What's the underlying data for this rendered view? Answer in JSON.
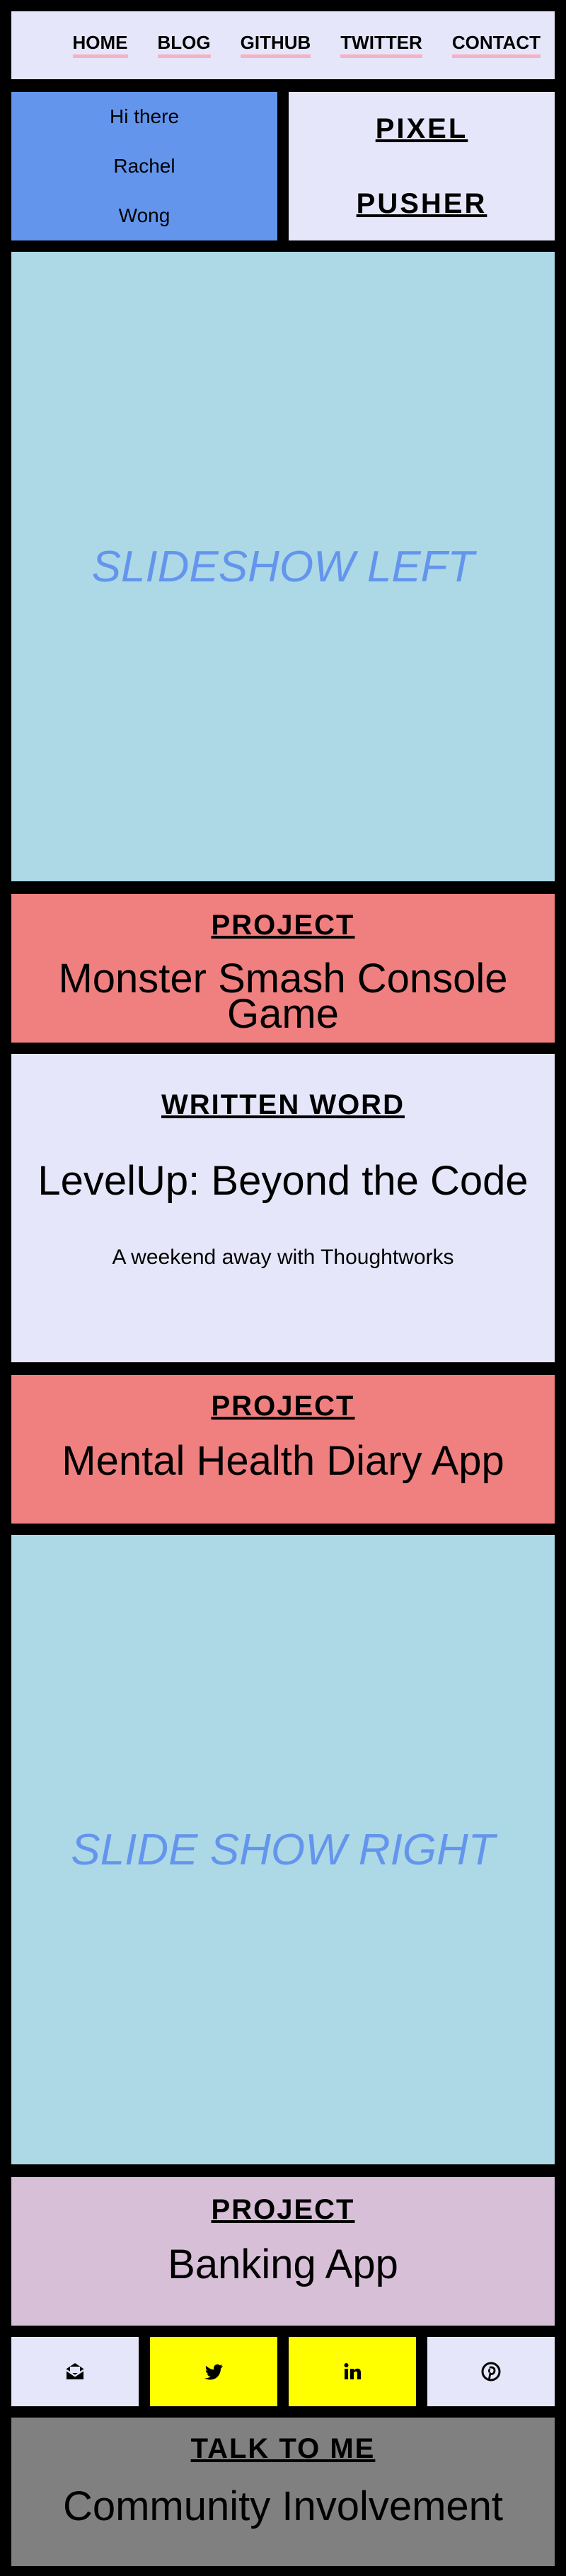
{
  "nav": {
    "items": [
      "HOME",
      "BLOG",
      "GITHUB",
      "TWITTER",
      "CONTACT"
    ]
  },
  "hero": {
    "greeting": [
      "Hi there",
      "Rachel",
      "Wong"
    ],
    "brand": [
      "PIXEL",
      "PUSHER"
    ]
  },
  "slideshow_left": "SLIDESHOW LEFT",
  "project1": {
    "label": "PROJECT",
    "title": "Monster Smash Console Game"
  },
  "written_word": {
    "label": "WRITTEN WORD",
    "title": "LevelUp: Beyond the Code",
    "subtitle": "A weekend away with Thoughtworks"
  },
  "project2": {
    "label": "PROJECT",
    "title": "Mental Health Diary App"
  },
  "slideshow_right": "SLIDE SHOW RIGHT",
  "project3": {
    "label": "PROJECT",
    "title": "Banking App"
  },
  "social": {
    "icons": [
      "email-icon",
      "twitter-icon",
      "linkedin-icon",
      "pinterest-icon"
    ]
  },
  "talk": {
    "label": "TALK TO ME",
    "title": "Community Involvement"
  },
  "colors": {
    "background": "#000000",
    "nav": "#e6e6fa",
    "greeting": "#6495ed",
    "slide": "#add8e6",
    "project": "#f08080",
    "banking": "#d8bfd8",
    "social_highlight": "#ffff00",
    "talk": "#808080",
    "nav_underline": "#f6b2c4"
  }
}
